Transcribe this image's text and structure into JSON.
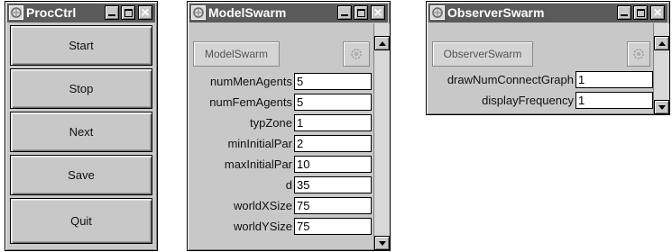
{
  "proc_ctrl": {
    "title": "ProcCtrl",
    "buttons": [
      "Start",
      "Stop",
      "Next",
      "Save",
      "Quit"
    ]
  },
  "model_swarm": {
    "title": "ModelSwarm",
    "header_button": "ModelSwarm",
    "fields": [
      {
        "label": "numMenAgents",
        "value": "5"
      },
      {
        "label": "numFemAgents",
        "value": "5"
      },
      {
        "label": "typZone",
        "value": "1"
      },
      {
        "label": "minInitialPar",
        "value": "2"
      },
      {
        "label": "maxInitialPar",
        "value": "10"
      },
      {
        "label": "d",
        "value": "35"
      },
      {
        "label": "worldXSize",
        "value": "75"
      },
      {
        "label": "worldYSize",
        "value": "75"
      }
    ]
  },
  "observer_swarm": {
    "title": "ObserverSwarm",
    "header_button": "ObserverSwarm",
    "fields": [
      {
        "label": "drawNumConnectGraph",
        "value": "1"
      },
      {
        "label": "displayFrequency",
        "value": "1"
      }
    ]
  },
  "icons": {
    "window_icon": "app-icon",
    "minimize": "minimize-icon",
    "maximize": "maximize-icon",
    "close": "close-icon",
    "probe": "gear-icon",
    "scroll_up": "up-arrow-icon",
    "scroll_down": "down-arrow-icon"
  },
  "colors": {
    "window_bg": "#c8c8c8",
    "titlebar": "#5a5a5a",
    "field_bg": "#ffffff"
  }
}
